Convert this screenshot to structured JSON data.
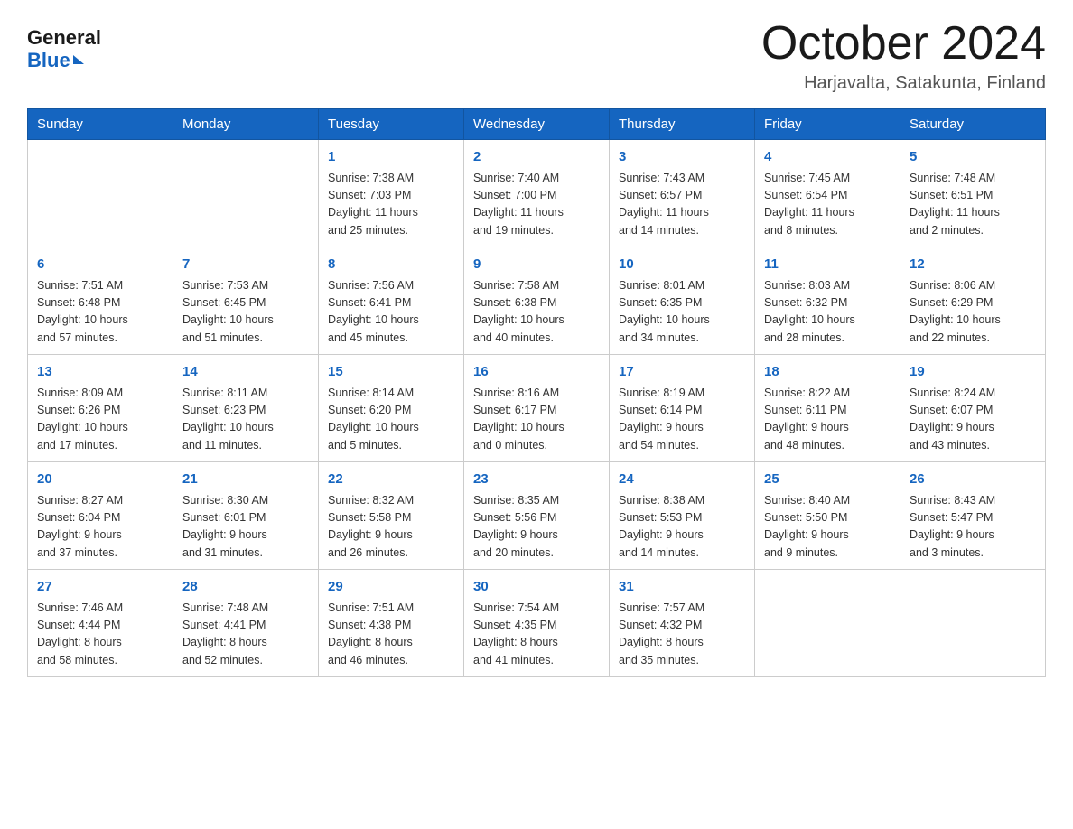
{
  "logo": {
    "general": "General",
    "blue": "Blue"
  },
  "title": "October 2024",
  "location": "Harjavalta, Satakunta, Finland",
  "days_of_week": [
    "Sunday",
    "Monday",
    "Tuesday",
    "Wednesday",
    "Thursday",
    "Friday",
    "Saturday"
  ],
  "weeks": [
    [
      {
        "day": "",
        "info": ""
      },
      {
        "day": "",
        "info": ""
      },
      {
        "day": "1",
        "info": "Sunrise: 7:38 AM\nSunset: 7:03 PM\nDaylight: 11 hours\nand 25 minutes."
      },
      {
        "day": "2",
        "info": "Sunrise: 7:40 AM\nSunset: 7:00 PM\nDaylight: 11 hours\nand 19 minutes."
      },
      {
        "day": "3",
        "info": "Sunrise: 7:43 AM\nSunset: 6:57 PM\nDaylight: 11 hours\nand 14 minutes."
      },
      {
        "day": "4",
        "info": "Sunrise: 7:45 AM\nSunset: 6:54 PM\nDaylight: 11 hours\nand 8 minutes."
      },
      {
        "day": "5",
        "info": "Sunrise: 7:48 AM\nSunset: 6:51 PM\nDaylight: 11 hours\nand 2 minutes."
      }
    ],
    [
      {
        "day": "6",
        "info": "Sunrise: 7:51 AM\nSunset: 6:48 PM\nDaylight: 10 hours\nand 57 minutes."
      },
      {
        "day": "7",
        "info": "Sunrise: 7:53 AM\nSunset: 6:45 PM\nDaylight: 10 hours\nand 51 minutes."
      },
      {
        "day": "8",
        "info": "Sunrise: 7:56 AM\nSunset: 6:41 PM\nDaylight: 10 hours\nand 45 minutes."
      },
      {
        "day": "9",
        "info": "Sunrise: 7:58 AM\nSunset: 6:38 PM\nDaylight: 10 hours\nand 40 minutes."
      },
      {
        "day": "10",
        "info": "Sunrise: 8:01 AM\nSunset: 6:35 PM\nDaylight: 10 hours\nand 34 minutes."
      },
      {
        "day": "11",
        "info": "Sunrise: 8:03 AM\nSunset: 6:32 PM\nDaylight: 10 hours\nand 28 minutes."
      },
      {
        "day": "12",
        "info": "Sunrise: 8:06 AM\nSunset: 6:29 PM\nDaylight: 10 hours\nand 22 minutes."
      }
    ],
    [
      {
        "day": "13",
        "info": "Sunrise: 8:09 AM\nSunset: 6:26 PM\nDaylight: 10 hours\nand 17 minutes."
      },
      {
        "day": "14",
        "info": "Sunrise: 8:11 AM\nSunset: 6:23 PM\nDaylight: 10 hours\nand 11 minutes."
      },
      {
        "day": "15",
        "info": "Sunrise: 8:14 AM\nSunset: 6:20 PM\nDaylight: 10 hours\nand 5 minutes."
      },
      {
        "day": "16",
        "info": "Sunrise: 8:16 AM\nSunset: 6:17 PM\nDaylight: 10 hours\nand 0 minutes."
      },
      {
        "day": "17",
        "info": "Sunrise: 8:19 AM\nSunset: 6:14 PM\nDaylight: 9 hours\nand 54 minutes."
      },
      {
        "day": "18",
        "info": "Sunrise: 8:22 AM\nSunset: 6:11 PM\nDaylight: 9 hours\nand 48 minutes."
      },
      {
        "day": "19",
        "info": "Sunrise: 8:24 AM\nSunset: 6:07 PM\nDaylight: 9 hours\nand 43 minutes."
      }
    ],
    [
      {
        "day": "20",
        "info": "Sunrise: 8:27 AM\nSunset: 6:04 PM\nDaylight: 9 hours\nand 37 minutes."
      },
      {
        "day": "21",
        "info": "Sunrise: 8:30 AM\nSunset: 6:01 PM\nDaylight: 9 hours\nand 31 minutes."
      },
      {
        "day": "22",
        "info": "Sunrise: 8:32 AM\nSunset: 5:58 PM\nDaylight: 9 hours\nand 26 minutes."
      },
      {
        "day": "23",
        "info": "Sunrise: 8:35 AM\nSunset: 5:56 PM\nDaylight: 9 hours\nand 20 minutes."
      },
      {
        "day": "24",
        "info": "Sunrise: 8:38 AM\nSunset: 5:53 PM\nDaylight: 9 hours\nand 14 minutes."
      },
      {
        "day": "25",
        "info": "Sunrise: 8:40 AM\nSunset: 5:50 PM\nDaylight: 9 hours\nand 9 minutes."
      },
      {
        "day": "26",
        "info": "Sunrise: 8:43 AM\nSunset: 5:47 PM\nDaylight: 9 hours\nand 3 minutes."
      }
    ],
    [
      {
        "day": "27",
        "info": "Sunrise: 7:46 AM\nSunset: 4:44 PM\nDaylight: 8 hours\nand 58 minutes."
      },
      {
        "day": "28",
        "info": "Sunrise: 7:48 AM\nSunset: 4:41 PM\nDaylight: 8 hours\nand 52 minutes."
      },
      {
        "day": "29",
        "info": "Sunrise: 7:51 AM\nSunset: 4:38 PM\nDaylight: 8 hours\nand 46 minutes."
      },
      {
        "day": "30",
        "info": "Sunrise: 7:54 AM\nSunset: 4:35 PM\nDaylight: 8 hours\nand 41 minutes."
      },
      {
        "day": "31",
        "info": "Sunrise: 7:57 AM\nSunset: 4:32 PM\nDaylight: 8 hours\nand 35 minutes."
      },
      {
        "day": "",
        "info": ""
      },
      {
        "day": "",
        "info": ""
      }
    ]
  ]
}
